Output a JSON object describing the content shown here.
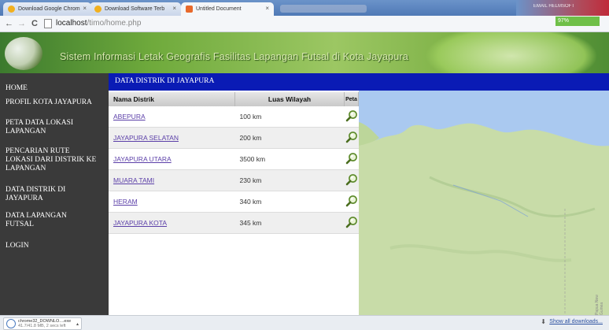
{
  "browser": {
    "tabs": [
      {
        "label": "Download Google Chrom",
        "active": false,
        "icon_color": "#f2b01e"
      },
      {
        "label": "Download Software Terb",
        "active": false,
        "icon_color": "#f2b01e"
      },
      {
        "label": "Untitled Document",
        "active": true,
        "icon_color": "#e8692b"
      }
    ],
    "tab_close": "×",
    "window_title": "EMAIL HELMSOFT",
    "progress": "97%",
    "back": "←",
    "forward": "→",
    "reload": "C",
    "url_host": "localhost",
    "url_path": "/timo/home.php"
  },
  "header": {
    "title": "Sistem Informasi Letak Geografis Fasilitas Lapangan Futsal di Kota Jayapura"
  },
  "sidebar": {
    "items": [
      {
        "label": "HOME"
      },
      {
        "label": "PROFIL KOTA JAYAPURA"
      },
      {
        "label": "PETA DATA LOKASI LAPANGAN"
      },
      {
        "label": "PENCARIAN RUTE LOKASI DARI DISTRIK KE LAPANGAN"
      },
      {
        "label": "DATA DISTRIK DI JAYAPURA"
      },
      {
        "label": "DATA LAPANGAN FUTSAL"
      },
      {
        "label": "LOGIN"
      }
    ]
  },
  "content": {
    "heading": "DATA DISTRIK DI JAYAPURA",
    "columns": [
      "Nama Distrik",
      "Luas Wilayah",
      "Peta"
    ],
    "rows": [
      {
        "name": "ABEPURA",
        "area": "100 km"
      },
      {
        "name": "JAYAPURA SELATAN",
        "area": "200 km"
      },
      {
        "name": "JAYAPURA UTARA",
        "area": "3500 km"
      },
      {
        "name": "MUARA TAMI",
        "area": "230 km"
      },
      {
        "name": "HERAM",
        "area": "340 km"
      },
      {
        "name": "JAYAPURA KOTA",
        "area": "345 km"
      }
    ]
  },
  "map": {
    "side_label": "Papua New Guinea"
  },
  "downloads": {
    "file_name": "chrome32_DOWNLO....exe",
    "file_status": "41.7/41.8 MB, 2 secs left",
    "show_all": "Show all downloads..."
  },
  "colors": {
    "sidebar_bg": "#3a3a3a",
    "heading_bg": "#0a1bb5",
    "link": "#5b3fa8",
    "map_land": "#c8dca8",
    "map_sea": "#aac9f0"
  }
}
